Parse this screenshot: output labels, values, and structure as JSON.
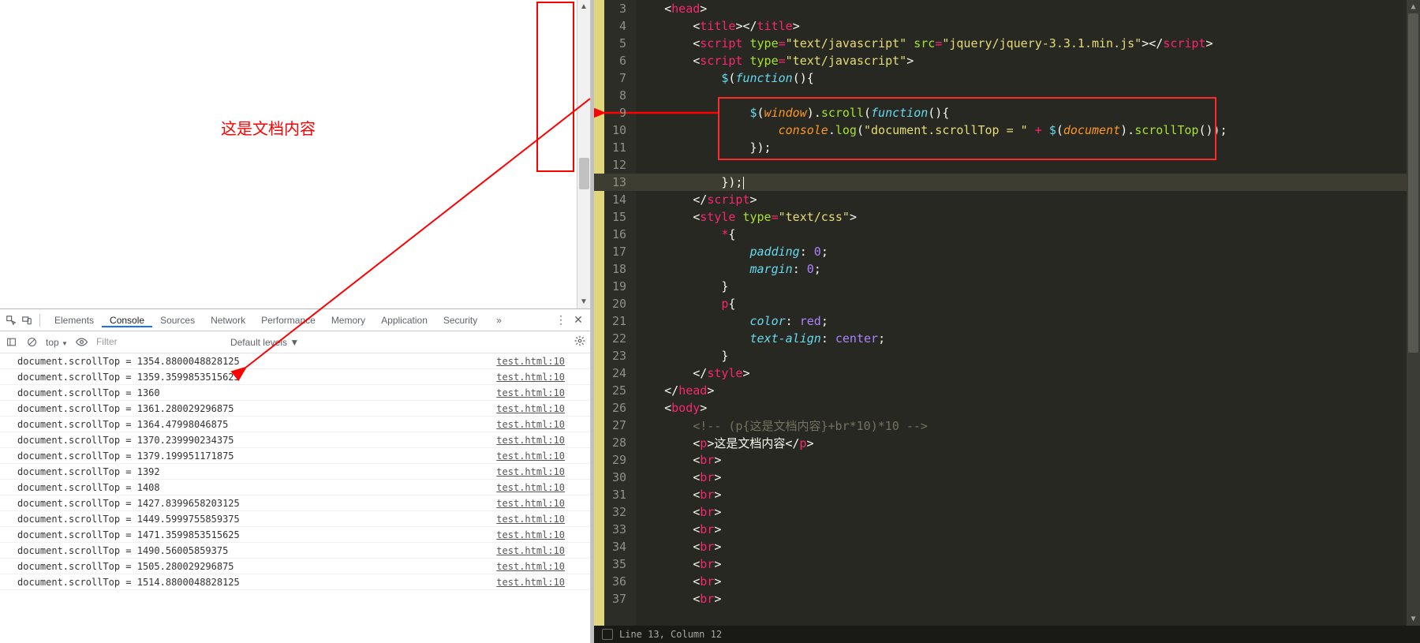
{
  "preview": {
    "doc_text": "这是文档内容"
  },
  "devtools": {
    "tabs": [
      "Elements",
      "Console",
      "Sources",
      "Network",
      "Performance",
      "Memory",
      "Application",
      "Security"
    ],
    "active_tab": 1,
    "more": "»",
    "context": "top",
    "context_arrow": "▼",
    "filter_placeholder": "Filter",
    "levels": "Default levels ▼",
    "log_src": "test.html:10",
    "logs": [
      "document.scrollTop = 1354.8800048828125",
      "document.scrollTop = 1359.3599853515625",
      "document.scrollTop = 1360",
      "document.scrollTop = 1361.280029296875",
      "document.scrollTop = 1364.47998046875",
      "document.scrollTop = 1370.239990234375",
      "document.scrollTop = 1379.199951171875",
      "document.scrollTop = 1392",
      "document.scrollTop = 1408",
      "document.scrollTop = 1427.8399658203125",
      "document.scrollTop = 1449.5999755859375",
      "document.scrollTop = 1471.3599853515625",
      "document.scrollTop = 1490.56005859375",
      "document.scrollTop = 1505.280029296875",
      "document.scrollTop = 1514.8800048828125"
    ]
  },
  "editor": {
    "status": "Line 13, Column 12",
    "lines": [
      {
        "n": 3,
        "html": "    <span class='t-ang'>&lt;</span><span class='t-tag'>head</span><span class='t-ang'>&gt;</span>"
      },
      {
        "n": 4,
        "html": "        <span class='t-ang'>&lt;</span><span class='t-tag'>title</span><span class='t-ang'>&gt;&lt;/</span><span class='t-tag'>title</span><span class='t-ang'>&gt;</span>"
      },
      {
        "n": 5,
        "html": "        <span class='t-ang'>&lt;</span><span class='t-tag'>script</span> <span class='t-attr'>type</span><span class='t-op'>=</span><span class='t-str'>\"text/javascript\"</span> <span class='t-attr'>src</span><span class='t-op'>=</span><span class='t-str'>\"jquery/jquery-3.3.1.min.js\"</span><span class='t-ang'>&gt;&lt;/</span><span class='t-tag'>script</span><span class='t-ang'>&gt;</span>"
      },
      {
        "n": 6,
        "html": "        <span class='t-ang'>&lt;</span><span class='t-tag'>script</span> <span class='t-attr'>type</span><span class='t-op'>=</span><span class='t-str'>\"text/javascript\"</span><span class='t-ang'>&gt;</span>"
      },
      {
        "n": 7,
        "html": "            <span class='t-fn'>$</span><span class='t-pl'>(</span><span class='t-key'>function</span><span class='t-pl'>(){</span>"
      },
      {
        "n": 8,
        "html": " "
      },
      {
        "n": 9,
        "html": "                <span class='t-fn'>$</span><span class='t-pl'>(</span><span class='t-var'>window</span><span class='t-pl'>).</span><span class='t-func'>scroll</span><span class='t-pl'>(</span><span class='t-key'>function</span><span class='t-pl'>(){</span>"
      },
      {
        "n": 10,
        "html": "                    <span class='t-var'>console</span><span class='t-pl'>.</span><span class='t-func'>log</span><span class='t-pl'>(</span><span class='t-str'>\"document.scrollTop = \"</span> <span class='t-op'>+</span> <span class='t-fn'>$</span><span class='t-pl'>(</span><span class='t-var'>document</span><span class='t-pl'>).</span><span class='t-func'>scrollTop</span><span class='t-pl'>());</span>"
      },
      {
        "n": 11,
        "html": "                <span class='t-pl'>});</span>"
      },
      {
        "n": 12,
        "html": " "
      },
      {
        "n": 13,
        "html": "            <span class='t-pl'>});</span><span class='cursor'></span>"
      },
      {
        "n": 14,
        "html": "        <span class='t-ang'>&lt;/</span><span class='t-tag'>script</span><span class='t-ang'>&gt;</span>"
      },
      {
        "n": 15,
        "html": "        <span class='t-ang'>&lt;</span><span class='t-tag'>style</span> <span class='t-attr'>type</span><span class='t-op'>=</span><span class='t-str'>\"text/css\"</span><span class='t-ang'>&gt;</span>"
      },
      {
        "n": 16,
        "html": "            <span class='t-tag'>*</span><span class='t-pl'>{</span>"
      },
      {
        "n": 17,
        "html": "                <span class='t-prop'>padding</span><span class='t-pl'>: </span><span class='t-num'>0</span><span class='t-pl'>;</span>"
      },
      {
        "n": 18,
        "html": "                <span class='t-prop'>margin</span><span class='t-pl'>: </span><span class='t-num'>0</span><span class='t-pl'>;</span>"
      },
      {
        "n": 19,
        "html": "            <span class='t-pl'>}</span>"
      },
      {
        "n": 20,
        "html": "            <span class='t-tag'>p</span><span class='t-pl'>{</span>"
      },
      {
        "n": 21,
        "html": "                <span class='t-prop'>color</span><span class='t-pl'>: </span><span class='t-num'>red</span><span class='t-pl'>;</span>"
      },
      {
        "n": 22,
        "html": "                <span class='t-prop'>text-align</span><span class='t-pl'>: </span><span class='t-num'>center</span><span class='t-pl'>;</span>"
      },
      {
        "n": 23,
        "html": "            <span class='t-pl'>}</span>"
      },
      {
        "n": 24,
        "html": "        <span class='t-ang'>&lt;/</span><span class='t-tag'>style</span><span class='t-ang'>&gt;</span>"
      },
      {
        "n": 25,
        "html": "    <span class='t-ang'>&lt;/</span><span class='t-tag'>head</span><span class='t-ang'>&gt;</span>"
      },
      {
        "n": 26,
        "html": "    <span class='t-ang'>&lt;</span><span class='t-tag'>body</span><span class='t-ang'>&gt;</span>"
      },
      {
        "n": 27,
        "html": "        <span class='t-cm'>&lt;!-- (p{这是文档内容}+br*10)*10 --&gt;</span>"
      },
      {
        "n": 28,
        "html": "        <span class='t-ang'>&lt;</span><span class='t-tag'>p</span><span class='t-ang'>&gt;</span><span class='t-pl'>这是文档内容</span><span class='t-ang'>&lt;/</span><span class='t-tag'>p</span><span class='t-ang'>&gt;</span>"
      },
      {
        "n": 29,
        "html": "        <span class='t-ang'>&lt;</span><span class='t-tag'>br</span><span class='t-ang'>&gt;</span>"
      },
      {
        "n": 30,
        "html": "        <span class='t-ang'>&lt;</span><span class='t-tag'>br</span><span class='t-ang'>&gt;</span>"
      },
      {
        "n": 31,
        "html": "        <span class='t-ang'>&lt;</span><span class='t-tag'>br</span><span class='t-ang'>&gt;</span>"
      },
      {
        "n": 32,
        "html": "        <span class='t-ang'>&lt;</span><span class='t-tag'>br</span><span class='t-ang'>&gt;</span>"
      },
      {
        "n": 33,
        "html": "        <span class='t-ang'>&lt;</span><span class='t-tag'>br</span><span class='t-ang'>&gt;</span>"
      },
      {
        "n": 34,
        "html": "        <span class='t-ang'>&lt;</span><span class='t-tag'>br</span><span class='t-ang'>&gt;</span>"
      },
      {
        "n": 35,
        "html": "        <span class='t-ang'>&lt;</span><span class='t-tag'>br</span><span class='t-ang'>&gt;</span>"
      },
      {
        "n": 36,
        "html": "        <span class='t-ang'>&lt;</span><span class='t-tag'>br</span><span class='t-ang'>&gt;</span>"
      },
      {
        "n": 37,
        "html": "        <span class='t-ang'>&lt;</span><span class='t-tag'>br</span><span class='t-ang'>&gt;</span>"
      }
    ]
  }
}
